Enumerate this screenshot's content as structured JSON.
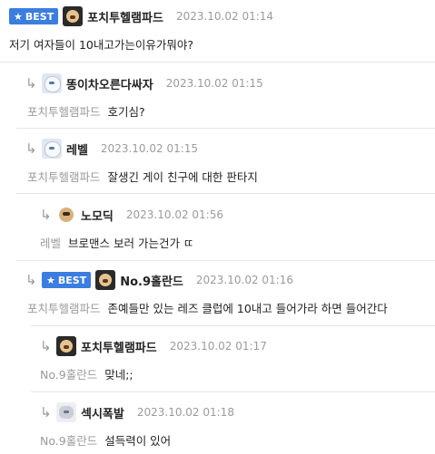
{
  "best_label": "BEST",
  "comments": [
    {
      "nick": "포치투헬램파드",
      "time": "2023.10.02 01:14",
      "mention": "",
      "text": "저기 여자들이 10내고가는이유가뭐야?"
    },
    {
      "nick": "똥이차오른다싸자",
      "time": "2023.10.02 01:15",
      "mention": "포치투헬램파드",
      "text": "호기심?"
    },
    {
      "nick": "레벨",
      "time": "2023.10.02 01:15",
      "mention": "포치투헬램파드",
      "text": "잘생긴 게이 친구에 대한 판타지"
    },
    {
      "nick": "노모딕",
      "time": "2023.10.02 01:56",
      "mention": "레벨",
      "text": "브로맨스 보러 가는건가 ㄸ"
    },
    {
      "nick": "No.9홀란드",
      "time": "2023.10.02 01:16",
      "mention": "포치투헬램파드",
      "text": "존예들만 있는 레즈 클럽에 10내고 들어가라 하면 들어간다"
    },
    {
      "nick": "포치투헬램파드",
      "time": "2023.10.02 01:17",
      "mention": "No.9홀란드",
      "text": "맞네;;"
    },
    {
      "nick": "섹시폭발",
      "time": "2023.10.02 01:18",
      "mention": "No.9홀란드",
      "text": "설득력이 있어"
    }
  ]
}
